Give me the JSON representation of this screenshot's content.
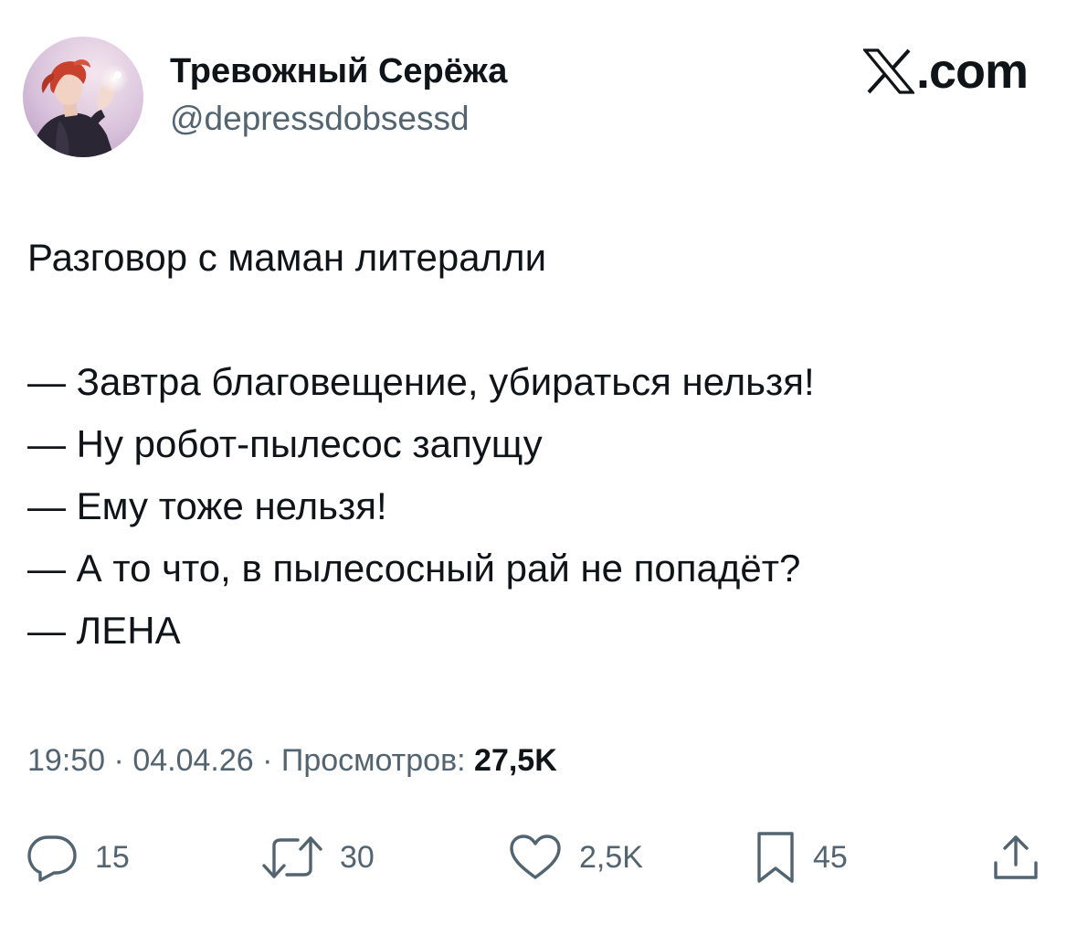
{
  "author": {
    "display_name": "Тревожный Серёжа",
    "handle": "@depressdobsessd",
    "avatar_icon": "anime-character-avatar"
  },
  "brand": {
    "logo_icon": "x-logo-icon",
    "text": ".com"
  },
  "tweet": {
    "lines": [
      "Разговор с маман литералли",
      "",
      "— Завтра благовещение, убираться нельзя!",
      "— Ну робот-пылесос запущу",
      "— Ему тоже нельзя!",
      "— А то что, в пылесосный рай не попадёт?",
      "— ЛЕНА"
    ]
  },
  "meta": {
    "time": "19:50",
    "separator": " · ",
    "date": "04.04.26",
    "views_label": "Просмотров: ",
    "views_count": "27,5K"
  },
  "actions": {
    "reply": {
      "icon": "reply-icon",
      "count": "15"
    },
    "retweet": {
      "icon": "retweet-icon",
      "count": "30"
    },
    "like": {
      "icon": "heart-icon",
      "count": "2,5K"
    },
    "bookmark": {
      "icon": "bookmark-icon",
      "count": "45"
    },
    "share": {
      "icon": "share-icon"
    }
  },
  "colors": {
    "text_primary": "#0f1419",
    "text_secondary": "#536471",
    "background": "#ffffff"
  }
}
